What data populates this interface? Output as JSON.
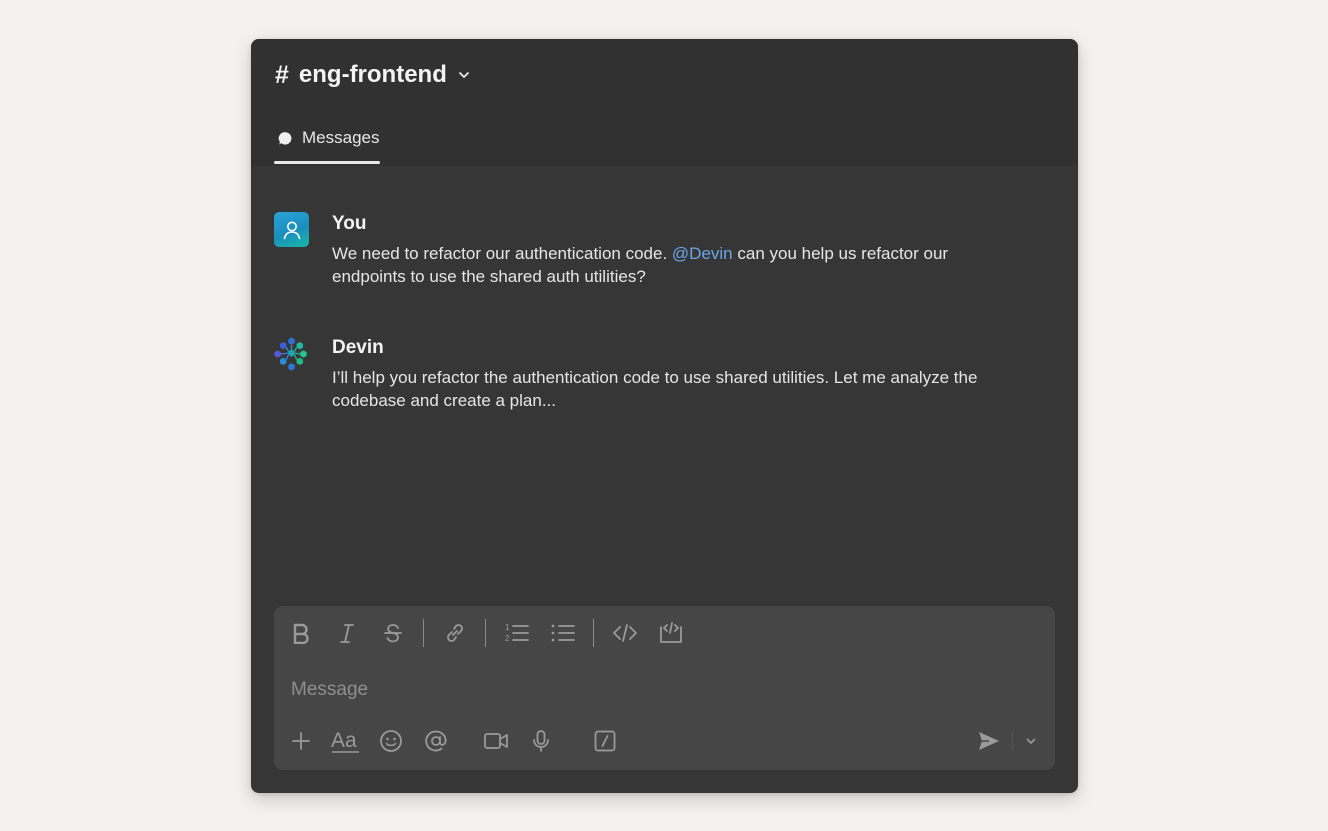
{
  "channel": {
    "hash": "#",
    "name": "eng-frontend"
  },
  "tabs": [
    {
      "label": "Messages",
      "active": true
    }
  ],
  "messages": [
    {
      "sender": "You",
      "avatar_icon": "user-icon",
      "text_before": "We need to refactor our authentication code. ",
      "mention": "@Devin",
      "text_after": " can you help us refactor our endpoints to use the shared auth utilities?"
    },
    {
      "sender": "Devin",
      "avatar_icon": "devin-logo-icon",
      "text": "I’ll help you refactor the authentication code to use shared utilities. Let me analyze the codebase and create a plan..."
    }
  ],
  "composer": {
    "placeholder": "Message",
    "value": ""
  },
  "colors": {
    "background": "#f3f2f0",
    "window": "#363636",
    "header": "#313131",
    "composer": "#464646",
    "mention": "#6aa7e8"
  }
}
